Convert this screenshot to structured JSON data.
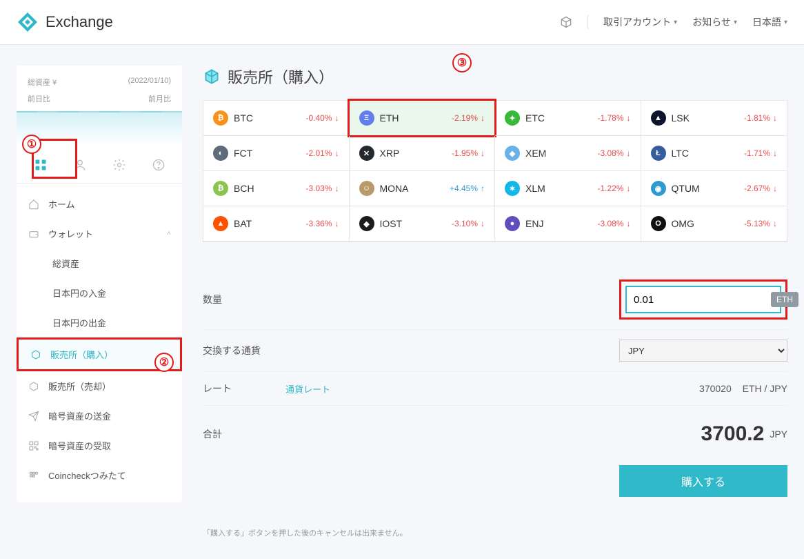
{
  "header": {
    "brand": "Exchange",
    "account_menu": "取引アカウント",
    "notice_menu": "お知らせ",
    "lang_menu": "日本語"
  },
  "sidebar": {
    "total_assets_label": "総資産",
    "currency_mark": "¥",
    "date": "(2022/01/10)",
    "prev_day": "前日比",
    "prev_month": "前月比",
    "annotations": {
      "one": "①",
      "two": "②",
      "three": "③"
    },
    "items": [
      {
        "label": "ホーム",
        "icon": "home"
      },
      {
        "label": "ウォレット",
        "icon": "wallet",
        "expand": true
      },
      {
        "label": "総資産",
        "sub": true
      },
      {
        "label": "日本円の入金",
        "sub": true
      },
      {
        "label": "日本円の出金",
        "sub": true
      },
      {
        "label": "販売所（購入）",
        "icon": "cube-in",
        "active": true
      },
      {
        "label": "販売所（売却）",
        "icon": "cube-out"
      },
      {
        "label": "暗号資産の送金",
        "icon": "send"
      },
      {
        "label": "暗号資産の受取",
        "icon": "qr"
      },
      {
        "label": "Coincheckつみたて",
        "icon": "stack"
      }
    ]
  },
  "main": {
    "title": "販売所（購入）",
    "coins": [
      {
        "sym": "BTC",
        "pct": "-0.40%",
        "dir": "down",
        "bg": "#f7931a",
        "glyph": "₿"
      },
      {
        "sym": "ETH",
        "pct": "-2.19%",
        "dir": "down",
        "bg": "#627eea",
        "glyph": "Ξ",
        "selected": true
      },
      {
        "sym": "ETC",
        "pct": "-1.78%",
        "dir": "down",
        "bg": "#3ab83a",
        "glyph": "✦"
      },
      {
        "sym": "LSK",
        "pct": "-1.81%",
        "dir": "down",
        "bg": "#0c152e",
        "glyph": "▲"
      },
      {
        "sym": "FCT",
        "pct": "-2.01%",
        "dir": "down",
        "bg": "#5f6b7a",
        "glyph": "◐"
      },
      {
        "sym": "XRP",
        "pct": "-1.95%",
        "dir": "down",
        "bg": "#23292f",
        "glyph": "✕"
      },
      {
        "sym": "XEM",
        "pct": "-3.08%",
        "dir": "down",
        "bg": "#67b2e8",
        "glyph": "◆"
      },
      {
        "sym": "LTC",
        "pct": "-1.71%",
        "dir": "down",
        "bg": "#345d9d",
        "glyph": "Ł"
      },
      {
        "sym": "BCH",
        "pct": "-3.03%",
        "dir": "down",
        "bg": "#8dc351",
        "glyph": "₿"
      },
      {
        "sym": "MONA",
        "pct": "+4.45%",
        "dir": "up",
        "bg": "#b89a6b",
        "glyph": "☺"
      },
      {
        "sym": "XLM",
        "pct": "-1.22%",
        "dir": "down",
        "bg": "#14b6e7",
        "glyph": "✶"
      },
      {
        "sym": "QTUM",
        "pct": "-2.67%",
        "dir": "down",
        "bg": "#2e9ad0",
        "glyph": "◉"
      },
      {
        "sym": "BAT",
        "pct": "-3.36%",
        "dir": "down",
        "bg": "#ff5000",
        "glyph": "▲"
      },
      {
        "sym": "IOST",
        "pct": "-3.10%",
        "dir": "down",
        "bg": "#1c1c1c",
        "glyph": "◆"
      },
      {
        "sym": "ENJ",
        "pct": "-3.08%",
        "dir": "down",
        "bg": "#624dbf",
        "glyph": "●"
      },
      {
        "sym": "OMG",
        "pct": "-5.13%",
        "dir": "down",
        "bg": "#101010",
        "glyph": "O"
      }
    ],
    "form": {
      "qty_label": "数量",
      "qty_value": "0.01",
      "qty_unit": "ETH",
      "exchange_currency_label": "交換する通貨",
      "exchange_currency_value": "JPY",
      "rate_label": "レート",
      "rate_link": "通貨レート",
      "rate_value": "370020",
      "rate_pair": "ETH / JPY",
      "total_label": "合計",
      "total_value": "3700.2",
      "total_unit": "JPY",
      "buy_button": "購入する",
      "disclaimer": "「購入する」ボタンを押した後のキャンセルは出来ません。"
    }
  }
}
